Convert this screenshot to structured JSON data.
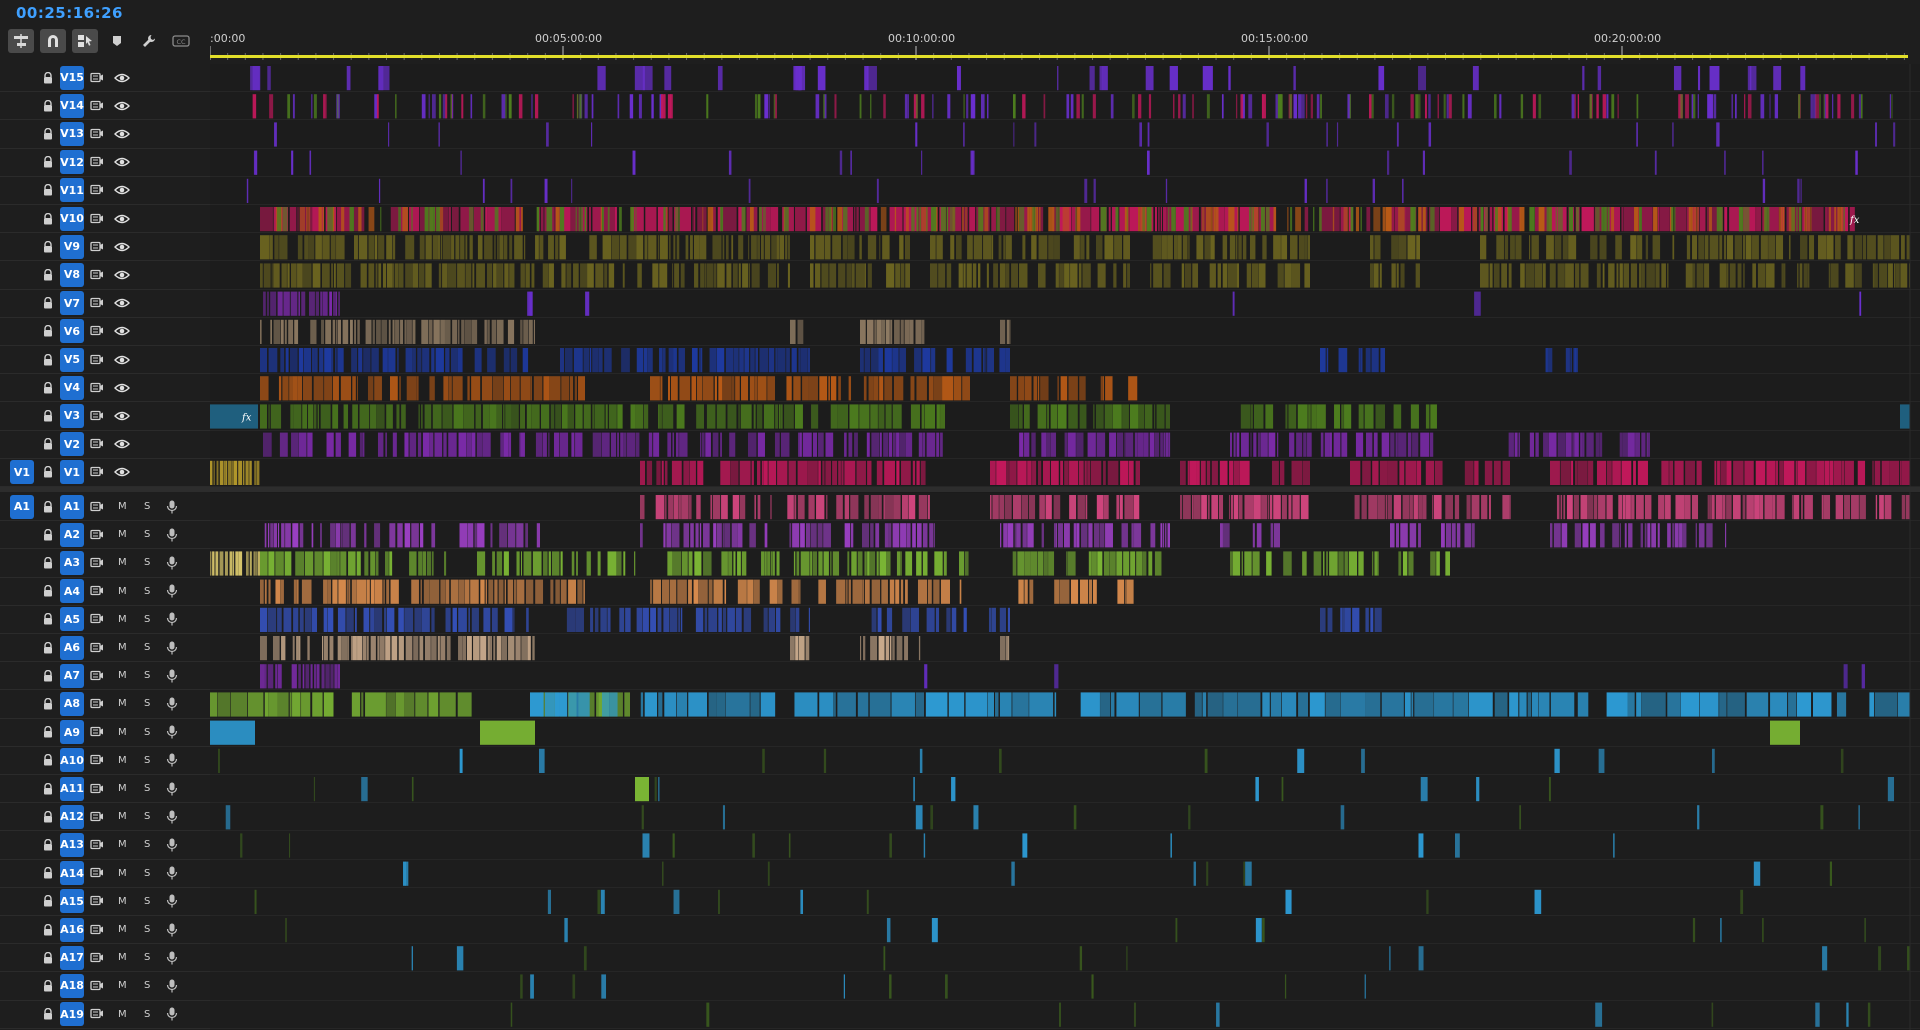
{
  "timecode": "00:25:16:26",
  "toolbar": {
    "tools": [
      {
        "name": "insert-overwrite-sequences-as-nests-tool",
        "icon": "nest-icon",
        "active": true
      },
      {
        "name": "snap-tool",
        "icon": "magnet-icon",
        "active": true
      },
      {
        "name": "linked-selection-tool",
        "icon": "linked-selection-icon",
        "active": true
      },
      {
        "name": "add-marker-tool",
        "icon": "marker-icon",
        "active": false
      },
      {
        "name": "timeline-settings-tool",
        "icon": "wrench-icon",
        "active": false
      },
      {
        "name": "captions-tool",
        "icon": "cc-icon",
        "active": false
      }
    ]
  },
  "ruler": {
    "labels": [
      ":00:00",
      "00:05:00:00",
      "00:10:00:00",
      "00:15:00:00",
      "00:20:00:00"
    ]
  },
  "source_patch": {
    "video": "V1",
    "audio": "A1"
  },
  "video_tracks": [
    "V15",
    "V14",
    "V13",
    "V12",
    "V11",
    "V10",
    "V9",
    "V8",
    "V7",
    "V6",
    "V5",
    "V4",
    "V3",
    "V2",
    "V1"
  ],
  "audio_tracks": [
    "A1",
    "A2",
    "A3",
    "A4",
    "A5",
    "A6",
    "A7",
    "A8",
    "A9",
    "A10",
    "A11",
    "A12",
    "A13",
    "A14",
    "A15",
    "A16",
    "A17",
    "A18",
    "A19"
  ],
  "audio_buttons": {
    "mute": "M",
    "solo": "S"
  },
  "colors": {
    "accent": "#1f6fd1",
    "timecode": "#3fa0ff",
    "workarea": "#e2df2a",
    "clip_violet": "#6a2fcf",
    "clip_magenta": "#c2185b",
    "clip_olive": "#6b6420",
    "clip_tan": "#8e7a62",
    "clip_navy": "#1e3aa0",
    "clip_orange": "#b85a16",
    "clip_green": "#4d7d1e",
    "clip_purple": "#7a2aa8",
    "clip_cyan": "#2d9ad3",
    "clip_lime": "#7ab534"
  },
  "clip_effect_badge": "fx"
}
